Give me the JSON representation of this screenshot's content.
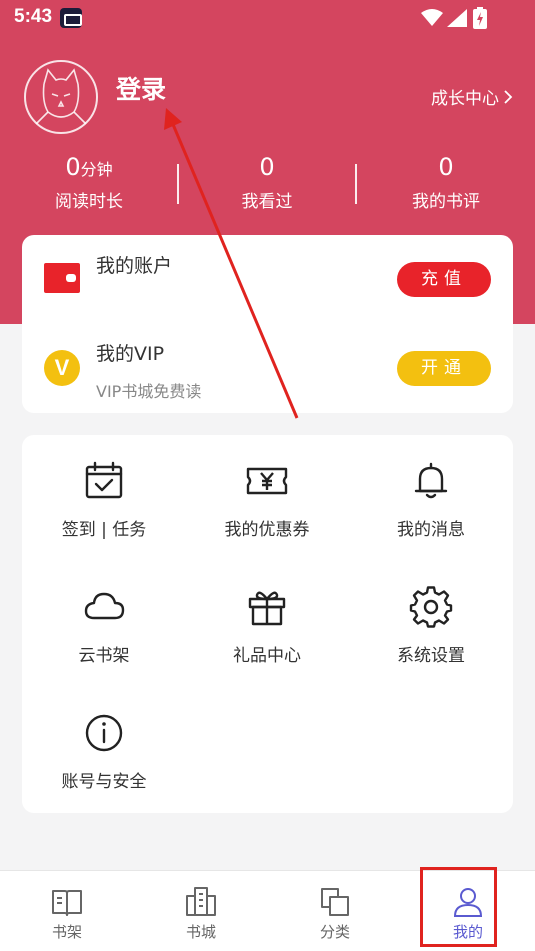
{
  "status_bar": {
    "time": "5:43"
  },
  "profile": {
    "login_label": "登录",
    "growth_center": "成长中心"
  },
  "stats": [
    {
      "value": "0",
      "unit": "分钟",
      "label": "阅读时长"
    },
    {
      "value": "0",
      "unit": "",
      "label": "我看过"
    },
    {
      "value": "0",
      "unit": "",
      "label": "我的书评"
    }
  ],
  "account": {
    "title": "我的账户",
    "recharge_button": "充值",
    "vip_title": "我的VIP",
    "vip_subtitle": "VIP书城免费读",
    "vip_icon_letter": "V",
    "open_button": "开通"
  },
  "menu": [
    {
      "label": "签到 | 任务",
      "icon": "calendar-check-icon"
    },
    {
      "label": "我的优惠券",
      "icon": "coupon-icon"
    },
    {
      "label": "我的消息",
      "icon": "bell-icon"
    },
    {
      "label": "云书架",
      "icon": "cloud-icon"
    },
    {
      "label": "礼品中心",
      "icon": "gift-icon"
    },
    {
      "label": "系统设置",
      "icon": "gear-icon"
    },
    {
      "label": "账号与安全",
      "icon": "info-icon"
    }
  ],
  "bottom_nav": [
    {
      "label": "书架",
      "icon": "book-icon",
      "active": false
    },
    {
      "label": "书城",
      "icon": "buildings-icon",
      "active": false
    },
    {
      "label": "分类",
      "icon": "category-icon",
      "active": false
    },
    {
      "label": "我的",
      "icon": "user-icon",
      "active": true
    }
  ],
  "colors": {
    "header": "#d4455f",
    "recharge": "#e8232a",
    "vip": "#f3c010",
    "nav_active": "#5a5ad0",
    "annotation": "#e0231f"
  }
}
